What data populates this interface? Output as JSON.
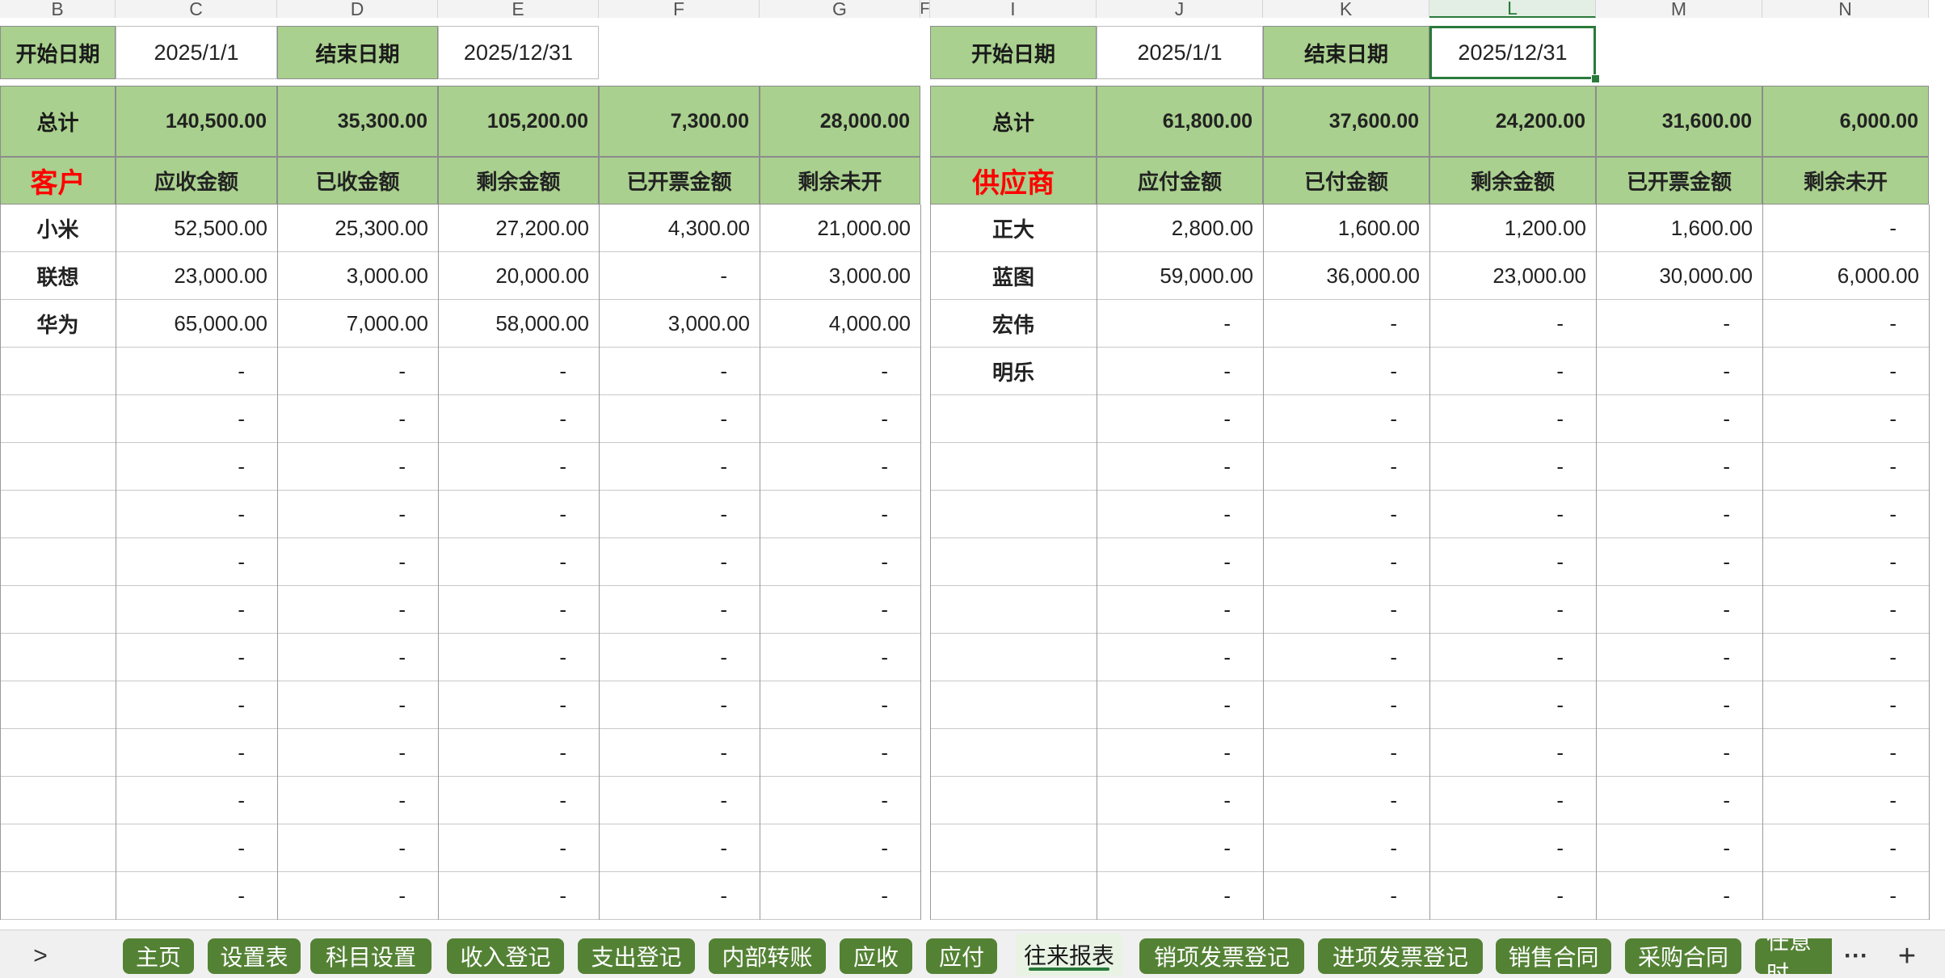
{
  "columns_left": [
    "B",
    "C",
    "D",
    "E",
    "F",
    "G"
  ],
  "columns_right": [
    "I",
    "J",
    "K",
    "L",
    "M",
    "N"
  ],
  "column_f_stub": "F",
  "left": {
    "start_label": "开始日期",
    "start_value": "2025/1/1",
    "end_label": "结束日期",
    "end_value": "2025/12/31",
    "total_label": "总计",
    "totals": [
      "140,500.00",
      "35,300.00",
      "105,200.00",
      "7,300.00",
      "28,000.00"
    ],
    "entity_header": "客户",
    "headers": [
      "应收金额",
      "已收金额",
      "剩余金额",
      "已开票金额",
      "剩余未开"
    ],
    "rows": [
      {
        "name": "小米",
        "values": [
          "52,500.00",
          "25,300.00",
          "27,200.00",
          "4,300.00",
          "21,000.00"
        ]
      },
      {
        "name": "联想",
        "values": [
          "23,000.00",
          "3,000.00",
          "20,000.00",
          "-",
          "3,000.00"
        ]
      },
      {
        "name": "华为",
        "values": [
          "65,000.00",
          "7,000.00",
          "58,000.00",
          "3,000.00",
          "4,000.00"
        ]
      },
      {
        "name": "",
        "values": [
          "-",
          "-",
          "-",
          "-",
          "-"
        ]
      },
      {
        "name": "",
        "values": [
          "-",
          "-",
          "-",
          "-",
          "-"
        ]
      },
      {
        "name": "",
        "values": [
          "-",
          "-",
          "-",
          "-",
          "-"
        ]
      },
      {
        "name": "",
        "values": [
          "-",
          "-",
          "-",
          "-",
          "-"
        ]
      },
      {
        "name": "",
        "values": [
          "-",
          "-",
          "-",
          "-",
          "-"
        ]
      },
      {
        "name": "",
        "values": [
          "-",
          "-",
          "-",
          "-",
          "-"
        ]
      },
      {
        "name": "",
        "values": [
          "-",
          "-",
          "-",
          "-",
          "-"
        ]
      },
      {
        "name": "",
        "values": [
          "-",
          "-",
          "-",
          "-",
          "-"
        ]
      },
      {
        "name": "",
        "values": [
          "-",
          "-",
          "-",
          "-",
          "-"
        ]
      },
      {
        "name": "",
        "values": [
          "-",
          "-",
          "-",
          "-",
          "-"
        ]
      },
      {
        "name": "",
        "values": [
          "-",
          "-",
          "-",
          "-",
          "-"
        ]
      },
      {
        "name": "",
        "values": [
          "-",
          "-",
          "-",
          "-",
          "-"
        ]
      }
    ]
  },
  "right": {
    "start_label": "开始日期",
    "start_value": "2025/1/1",
    "end_label": "结束日期",
    "end_value": "2025/12/31",
    "total_label": "总计",
    "totals": [
      "61,800.00",
      "37,600.00",
      "24,200.00",
      "31,600.00",
      "6,000.00"
    ],
    "entity_header": "供应商",
    "headers": [
      "应付金额",
      "已付金额",
      "剩余金额",
      "已开票金额",
      "剩余未开"
    ],
    "rows": [
      {
        "name": "正大",
        "values": [
          "2,800.00",
          "1,600.00",
          "1,200.00",
          "1,600.00",
          "-"
        ]
      },
      {
        "name": "蓝图",
        "values": [
          "59,000.00",
          "36,000.00",
          "23,000.00",
          "30,000.00",
          "6,000.00"
        ]
      },
      {
        "name": "宏伟",
        "values": [
          "-",
          "-",
          "-",
          "-",
          "-"
        ]
      },
      {
        "name": "明乐",
        "values": [
          "-",
          "-",
          "-",
          "-",
          "-"
        ]
      },
      {
        "name": "",
        "values": [
          "-",
          "-",
          "-",
          "-",
          "-"
        ]
      },
      {
        "name": "",
        "values": [
          "-",
          "-",
          "-",
          "-",
          "-"
        ]
      },
      {
        "name": "",
        "values": [
          "-",
          "-",
          "-",
          "-",
          "-"
        ]
      },
      {
        "name": "",
        "values": [
          "-",
          "-",
          "-",
          "-",
          "-"
        ]
      },
      {
        "name": "",
        "values": [
          "-",
          "-",
          "-",
          "-",
          "-"
        ]
      },
      {
        "name": "",
        "values": [
          "-",
          "-",
          "-",
          "-",
          "-"
        ]
      },
      {
        "name": "",
        "values": [
          "-",
          "-",
          "-",
          "-",
          "-"
        ]
      },
      {
        "name": "",
        "values": [
          "-",
          "-",
          "-",
          "-",
          "-"
        ]
      },
      {
        "name": "",
        "values": [
          "-",
          "-",
          "-",
          "-",
          "-"
        ]
      },
      {
        "name": "",
        "values": [
          "-",
          "-",
          "-",
          "-",
          "-"
        ]
      },
      {
        "name": "",
        "values": [
          "-",
          "-",
          "-",
          "-",
          "-"
        ]
      }
    ]
  },
  "tabs": {
    "nav_icon": "chevron-right-icon",
    "nav_symbol": ">",
    "items": [
      "主页",
      "设置表",
      "科目设置",
      "收入登记",
      "支出登记",
      "内部转账",
      "应收",
      "应付",
      "往来报表",
      "销项发票登记",
      "进项发票登记",
      "销售合同",
      "采购合同",
      "任意时"
    ],
    "active": "往来报表",
    "more_icon": "more-icon",
    "more_symbol": "···",
    "add_icon": "plus-icon",
    "add_symbol": "+"
  },
  "colors": {
    "header_green": "#a9d08e",
    "tab_green": "#548235",
    "entity_red": "#ff0000",
    "selection_green": "#2a7a3b"
  }
}
